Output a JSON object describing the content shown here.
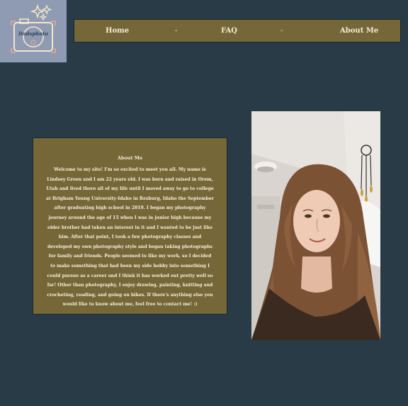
{
  "logo": {
    "text": "lindsphoto"
  },
  "nav": {
    "items": [
      {
        "label": "Home"
      },
      {
        "label": "FAQ"
      },
      {
        "label": "About Me"
      }
    ],
    "separator": "-"
  },
  "about": {
    "title": "About Me",
    "body": "Welcome to my site! I'm so excited to meet you all. My name is Lindsey Green and I am 22 years old. I was born and raised in Orem, Utah and lived there all of my life until I moved away to go to college at Brigham Young University-Idaho in Rexburg, Idaho the September after graduating high school in 2019. I began my photography journey around the age of 15 when I was in junior high because my older brother had taken an interest in it and I wanted to be just like him. After that point, I took a few photography classes and developed my own photography style and began taking photographs for family and friends. People seemed to like my work, so I decided to make something that had been my side hobby into something I could pursue as a career and I think it has worked out pretty well so far! Other than photography, I enjoy drawing, painting, knitting and crocheting, reading, and going on hikes. If there's anything else you would like to know about me, feel free to contact me! :)"
  },
  "colors": {
    "background": "#283b46",
    "nav_bar": "#756738",
    "logo_bg": "#8e9bb3",
    "text_light": "#f4ecd4"
  }
}
